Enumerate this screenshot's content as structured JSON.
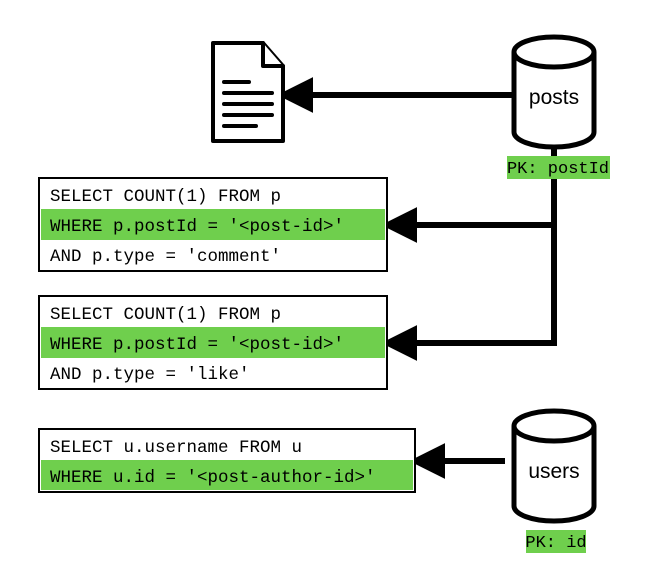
{
  "databases": {
    "posts": {
      "label": "posts",
      "pk": "PK: postId"
    },
    "users": {
      "label": "users",
      "pk": "PK: id"
    }
  },
  "queries": {
    "comments": {
      "l1": "SELECT COUNT(1) FROM p",
      "l2": "WHERE p.postId = '<post-id>'",
      "l3": "AND p.type = 'comment'"
    },
    "likes": {
      "l1": "SELECT COUNT(1) FROM p",
      "l2": "WHERE p.postId = '<post-id>'",
      "l3": "AND p.type = 'like'"
    },
    "author": {
      "l1": "SELECT u.username FROM u",
      "l2": "WHERE u.id = '<post-author-id>'"
    }
  }
}
